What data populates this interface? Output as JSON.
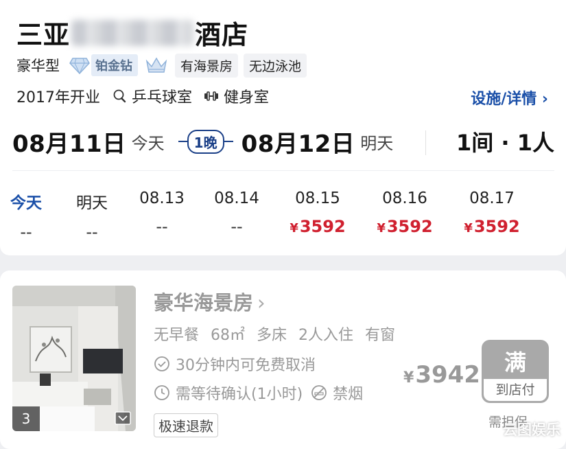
{
  "hotel": {
    "name_prefix": "三亚",
    "name_suffix": "酒店",
    "type": "豪华型",
    "rating_label": "铂金钻",
    "tags": [
      "有海景房",
      "无边泳池"
    ],
    "opened": "2017年开业",
    "facilities": [
      "乒乓球室",
      "健身室"
    ],
    "detail_link": "设施/详情 ›"
  },
  "stay": {
    "checkin": "08月11日",
    "checkin_label": "今天",
    "nights": "1晚",
    "checkout": "08月12日",
    "checkout_label": "明天",
    "guests": "1间 · 1人"
  },
  "calendar": [
    {
      "day": "今天",
      "price": "--",
      "today": true
    },
    {
      "day": "明天",
      "price": "--"
    },
    {
      "day": "08.13",
      "price": "--"
    },
    {
      "day": "08.14",
      "price": "--"
    },
    {
      "day": "08.15",
      "price": "3592",
      "currency": "¥"
    },
    {
      "day": "08.16",
      "price": "3592",
      "currency": "¥"
    },
    {
      "day": "08.17",
      "price": "3592",
      "currency": "¥"
    }
  ],
  "room": {
    "photo_count": "3",
    "name": "豪华海景房",
    "attrs": [
      "无早餐",
      "68㎡",
      "多床",
      "2人入住",
      "有窗"
    ],
    "cancel_policy": "30分钟内可免费取消",
    "confirm": "需等待确认(1小时)",
    "smoking": "禁烟",
    "refund_tag": "极速退款",
    "currency": "¥",
    "price": "3942",
    "status": "满",
    "pay_mode": "到店付",
    "below_button": "需担保"
  },
  "watermark": "云图娱乐",
  "colors": {
    "accent": "#1a4fa8",
    "price_red": "#d0202f",
    "disabled": "#a9a9a9"
  }
}
